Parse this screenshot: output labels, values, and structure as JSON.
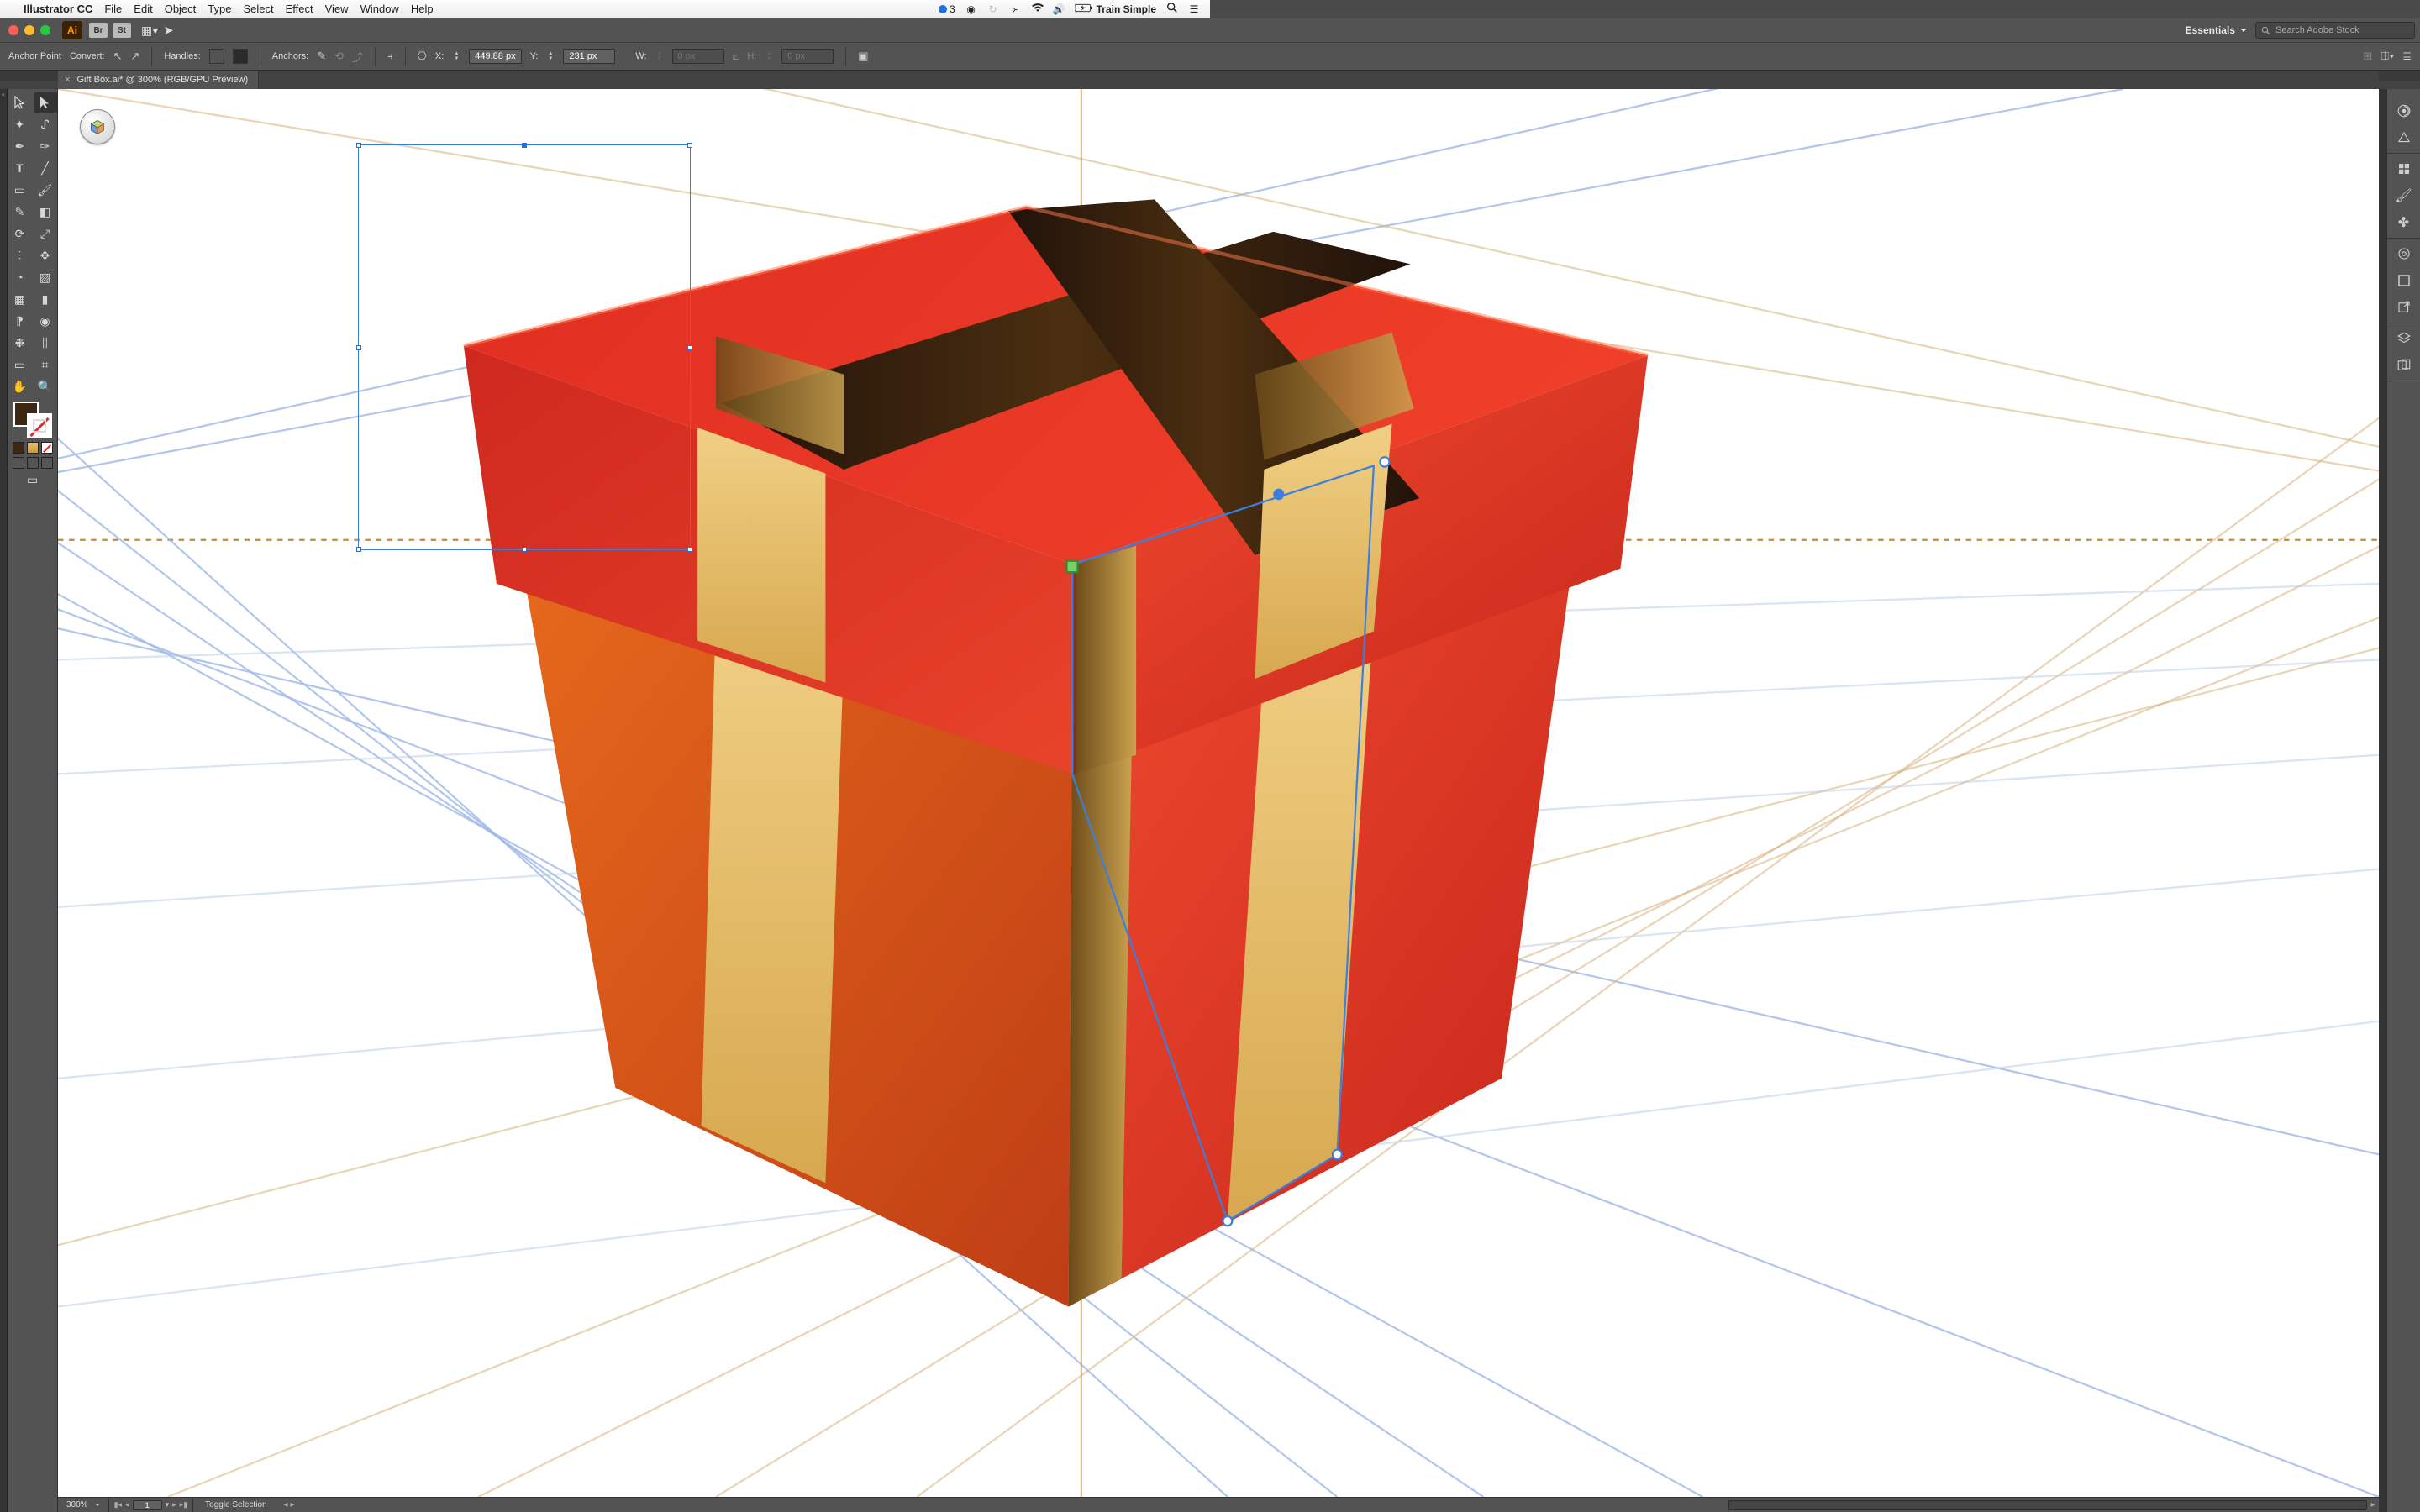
{
  "mac_menu": {
    "app": "Illustrator CC",
    "items": [
      "File",
      "Edit",
      "Object",
      "Type",
      "Select",
      "Effect",
      "View",
      "Window",
      "Help"
    ],
    "right_count": "3",
    "right_user": "Train Simple"
  },
  "app_bar": {
    "workspace": "Essentials",
    "search_placeholder": "Search Adobe Stock"
  },
  "control": {
    "mode": "Anchor Point",
    "convert": "Convert:",
    "handles": "Handles:",
    "anchors": "Anchors:",
    "x_label": "X:",
    "y_label": "Y:",
    "w_label": "W:",
    "h_label": "H:",
    "x_value": "449.88 px",
    "y_value": "231 px",
    "w_value": "0 px",
    "h_value": "0 px"
  },
  "tab": {
    "title": "Gift Box.ai* @ 300% (RGB/GPU Preview)"
  },
  "status": {
    "zoom": "300%",
    "artboard": "1",
    "hint": "Toggle Selection"
  },
  "colors": {
    "fill": "#3c2712",
    "box_red": "#e32f22",
    "box_red_dark": "#b71f17",
    "box_orange": "#e8691b",
    "ribbon_gold": "#e8c06a",
    "ribbon_gold_dark": "#c79a3b",
    "ribbon_top_dark": "#2c1608",
    "ribbon_top_mid": "#4d2f10"
  },
  "dock": {
    "icons": [
      "color-mixer",
      "color-guide",
      "swatches",
      "brushes",
      "symbols",
      "stroke",
      "gradient",
      "transparency",
      "appearance",
      "graphic-styles",
      "layers",
      "artboards"
    ]
  }
}
